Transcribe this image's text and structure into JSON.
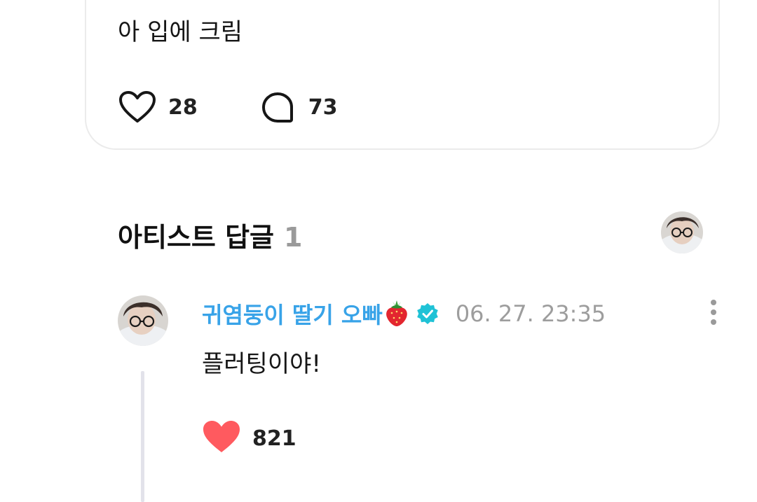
{
  "post": {
    "text": "아 입에 크림",
    "like_count": "28",
    "comment_count": "73"
  },
  "artist_replies": {
    "title": "아티스트 답글",
    "count": "1"
  },
  "reply": {
    "author": "귀염둥이 딸기 오빠",
    "author_emoji": "strawberry-icon",
    "verified_icon": "verified-badge-icon",
    "timestamp": "06. 27. 23:35",
    "text": "플러팅이야!",
    "like_count": "821"
  },
  "colors": {
    "author_name": "#38a3e8",
    "verified_badge": "#1fc2d6",
    "liked_heart": "#ff5a5f",
    "muted_text": "#9d9d9d",
    "thread_line": "#e2e2ea"
  }
}
